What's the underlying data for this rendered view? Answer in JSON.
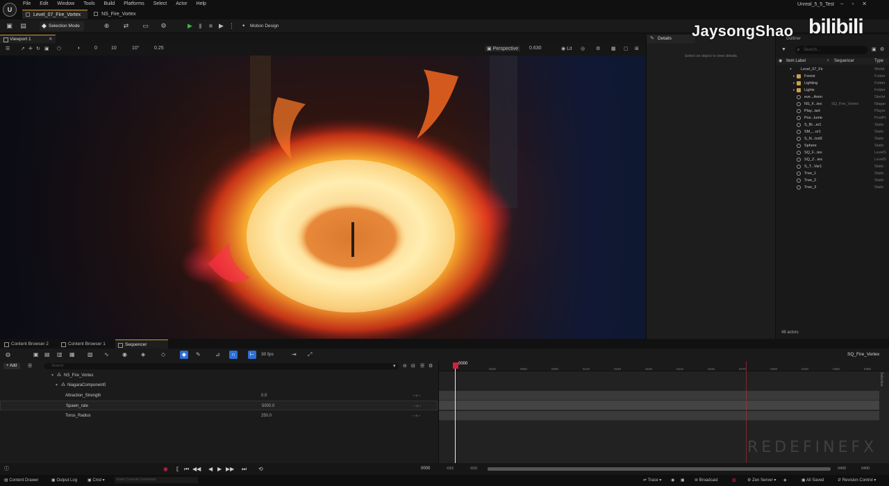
{
  "menubar": {
    "items": [
      "File",
      "Edit",
      "Window",
      "Tools",
      "Build",
      "Platforms",
      "Select",
      "Actor",
      "Help"
    ],
    "project_name": "Unreal_5_5_Test",
    "tabs": [
      "Level_07_Fire_Vortex",
      "NS_Fire_Vortex"
    ]
  },
  "toolbar": {
    "selection_mode": "Selection Mode",
    "motion_design": "Motion Design"
  },
  "viewport": {
    "tab": "Viewport 1",
    "perspective": "Perspective",
    "fov": "0.630",
    "lit": "Lit",
    "snap_translate": "10",
    "snap_rotate": "10°",
    "snap_scale": "0.25",
    "snap_zero": "0"
  },
  "details": {
    "tab": "Details",
    "hint": "Select an object to view details."
  },
  "outliner": {
    "tab": "Outliner",
    "search_placeholder": "Search...",
    "col_label": "Item Label",
    "col_sequencer": "Sequencer",
    "col_type": "Type",
    "root": {
      "label": "Level_07_Fir",
      "type": "World"
    },
    "items": [
      {
        "label": "Forest",
        "type": "Folder",
        "icon": "folder",
        "seq": ""
      },
      {
        "label": "Lighting",
        "type": "Folder",
        "icon": "folder",
        "seq": ""
      },
      {
        "label": "Lights",
        "type": "Folder",
        "icon": "folder",
        "seq": ""
      },
      {
        "label": "eve...Anim",
        "type": "Skelet",
        "icon": "mesh",
        "seq": ""
      },
      {
        "label": "NS_F...tex",
        "type": "Niagar",
        "icon": "mesh",
        "seq": "SQ_Fire_Vortex"
      },
      {
        "label": "Play...tart",
        "type": "Player",
        "icon": "mesh",
        "seq": ""
      },
      {
        "label": "Pos...lume",
        "type": "PostPr",
        "icon": "mesh",
        "seq": ""
      },
      {
        "label": "S_Br...ar1",
        "type": "Static",
        "icon": "mesh",
        "seq": ""
      },
      {
        "label": "SM_...or1",
        "type": "Static",
        "icon": "mesh",
        "seq": ""
      },
      {
        "label": "S_N...lod3",
        "type": "Static",
        "icon": "mesh",
        "seq": ""
      },
      {
        "label": "Sphere",
        "type": "Static",
        "icon": "mesh",
        "seq": ""
      },
      {
        "label": "SQ_F...tex",
        "type": "LevelS",
        "icon": "mesh",
        "seq": ""
      },
      {
        "label": "SQ_Z...ies",
        "type": "LevelS",
        "icon": "mesh",
        "seq": ""
      },
      {
        "label": "S_T...Var1",
        "type": "Static",
        "icon": "mesh",
        "seq": ""
      },
      {
        "label": "Tree_1",
        "type": "Static",
        "icon": "mesh",
        "seq": ""
      },
      {
        "label": "Tree_2",
        "type": "Static",
        "icon": "mesh",
        "seq": ""
      },
      {
        "label": "Tree_3",
        "type": "Static",
        "icon": "mesh",
        "seq": ""
      }
    ],
    "actor_count": "48 actors"
  },
  "watermark": {
    "author": "JaysongShao",
    "site": "bilibili",
    "studio": "REDEFINEFX"
  },
  "bottom_tabs": [
    "Content Browser 2",
    "Content Browser 1",
    "Sequencer"
  ],
  "sequencer": {
    "fps": "30 fps",
    "sequence_name": "SQ_Fire_Vortex",
    "add_label": "+ Add",
    "search_placeholder": "Search",
    "current_frame": "0000",
    "ruler_ticks": [
      "0030",
      "0060",
      "0090",
      "0120",
      "0150",
      "0180",
      "0210",
      "0240",
      "0270",
      "0300",
      "0330",
      "0360",
      "0390"
    ],
    "tracks": [
      {
        "name": "NS_Fire_Vortex",
        "value": ""
      },
      {
        "name": "NiagaraComponent0",
        "value": ""
      },
      {
        "name": "Attraction_Strength",
        "value": "0.0"
      },
      {
        "name": "Spawn_rate",
        "value": "5000.0"
      },
      {
        "name": "Torus_Radius",
        "value": "250.0"
      }
    ],
    "range_start": "-015",
    "range_start2": "-015",
    "range_end": "0400",
    "range_end2": "0400",
    "frame_display": "0000",
    "side_label": "Selection"
  },
  "statusbar": {
    "content_drawer": "Content Drawer",
    "output_log": "Output Log",
    "cmd": "Cmd",
    "console_placeholder": "Enter Console Command",
    "trace": "Trace",
    "broadcast": "Broadcast",
    "zen": "Zen Server",
    "saved": "All Saved",
    "revision": "Revision Control"
  },
  "colors": {
    "accent": "#d29a28",
    "play": "#3cb84a",
    "blue_btn": "#2d6fd6",
    "playhead": "#d02040"
  }
}
